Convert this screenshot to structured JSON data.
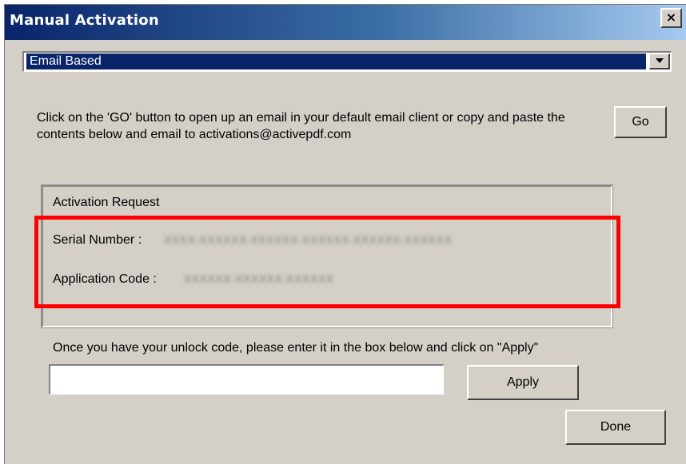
{
  "window": {
    "title": "Manual Activation",
    "close_glyph": "×",
    "close_icon": "close-icon"
  },
  "method_select": {
    "selected": "Email Based",
    "arrow_icon": "chevron-down-icon"
  },
  "instructions": {
    "text": "Click on the 'GO' button to open up an email in your default email client or copy and paste the contents below and email to activations@activepdf.com"
  },
  "go_button": {
    "label": "Go"
  },
  "activation_request": {
    "title": "Activation Request",
    "serial_label": "Serial Number :",
    "serial_value": "XXXX-XXXXXX-XXXXXX-XXXXXX-XXXXXX-XXXXXX",
    "appcode_label": "Application Code :",
    "appcode_value": "XXXXXX-XXXXXX-XXXXXX"
  },
  "unlock": {
    "instruction": "Once you have your unlock code, please enter it in the box below and click on \"Apply\"",
    "value": "",
    "placeholder": ""
  },
  "apply_button": {
    "label": "Apply"
  },
  "done_button": {
    "label": "Done"
  },
  "colors": {
    "title_gradient_start": "#0a246a",
    "title_gradient_end": "#a6caf0",
    "dialog_background": "#d4d0c8",
    "selection_background": "#0a246a",
    "highlight_border": "#ff0000"
  }
}
